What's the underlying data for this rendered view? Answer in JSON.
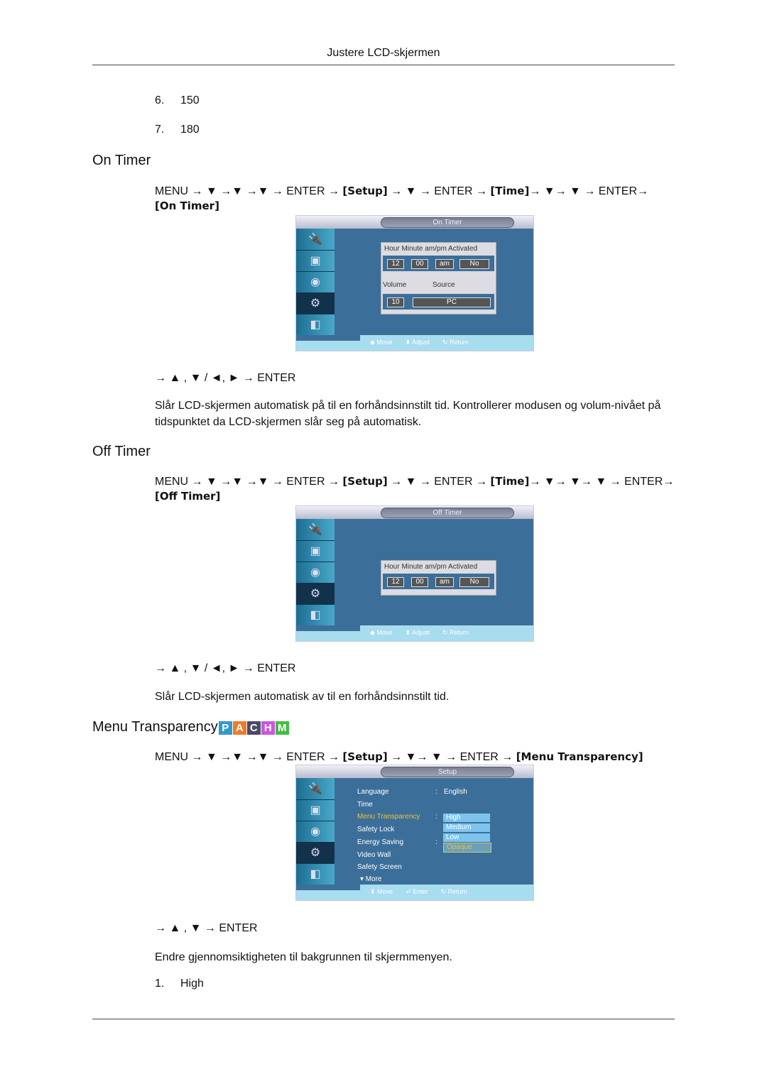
{
  "header": {
    "title": "Justere LCD-skjermen"
  },
  "top_list": [
    {
      "num": "6.",
      "text": "150"
    },
    {
      "num": "7.",
      "text": "180"
    }
  ],
  "on_timer": {
    "heading": "On Timer",
    "path_line1": "MENU → ▼ →▼ →▼ → ENTER → ",
    "path_setup": "[Setup]",
    "path_mid": " → ▼ → ENTER → ",
    "path_time": "[Time]",
    "path_end": "→ ▼→ ▼ → ENTER→",
    "path_target": "[On Timer]",
    "osd": {
      "title": "On Timer",
      "headers": "Hour  Minute am/pm Activated",
      "hour": "12",
      "minute": "00",
      "ampm": "am",
      "activated": "No",
      "volume_label": "Volume",
      "source_label": "Source",
      "volume": "10",
      "source": "PC",
      "footer": [
        "◆ Move",
        "⬍ Adjust",
        "↻ Return"
      ]
    },
    "nav": "→ ▲ , ▼ / ◄, ► → ENTER",
    "description": "Slår LCD-skjermen automatisk på til en forhåndsinnstilt tid. Kontrollerer modusen og volum-nivået på tidspunktet da LCD-skjermen slår seg på automatisk."
  },
  "off_timer": {
    "heading": "Off Timer",
    "path_line1": "MENU → ▼ →▼ →▼ → ENTER → ",
    "path_setup": "[Setup]",
    "path_mid": " → ▼ → ENTER → ",
    "path_time": "[Time]",
    "path_end": "→ ▼→ ▼→ ▼ → ENTER→",
    "path_target": "[Off Timer]",
    "osd": {
      "title": "Off Timer",
      "headers": "Hour  Minute am/pm Activated",
      "hour": "12",
      "minute": "00",
      "ampm": "am",
      "activated": "No",
      "footer": [
        "◆ Move",
        "⬍ Adjust",
        "↻ Return"
      ]
    },
    "nav": "→ ▲ , ▼ / ◄, ► → ENTER",
    "description": "Slår LCD-skjermen automatisk av til en forhåndsinnstilt tid."
  },
  "menu_transparency": {
    "heading": "Menu Transparency",
    "badges": [
      {
        "letter": "P",
        "color": "#3399cc"
      },
      {
        "letter": "A",
        "color": "#f07a2a"
      },
      {
        "letter": "C",
        "color": "#4a4a66"
      },
      {
        "letter": "H",
        "color": "#cc55dd"
      },
      {
        "letter": "M",
        "color": "#44bb44"
      }
    ],
    "path_line1": "MENU → ▼ →▼ →▼ → ENTER → ",
    "path_setup": "[Setup]",
    "path_mid": " → ▼→ ▼ → ENTER → ",
    "path_target": "[Menu Transparency]",
    "osd": {
      "title": "Setup",
      "items": [
        "Language",
        "Time",
        "Menu Transparency",
        "Safety Lock",
        "Energy Saving",
        "Video Wall",
        "Safety Screen"
      ],
      "more": "▾ More",
      "language_value": "English",
      "options": [
        "High",
        "Medium",
        "Low",
        "Opaque"
      ],
      "footer": [
        "⬍ Move",
        "⏎ Enter",
        "↻ Return"
      ]
    },
    "nav": "→ ▲ , ▼ → ENTER",
    "description": "Endre gjennomsiktigheten til bakgrunnen til skjermmenyen.",
    "list": [
      {
        "num": "1.",
        "text": "High"
      }
    ]
  }
}
